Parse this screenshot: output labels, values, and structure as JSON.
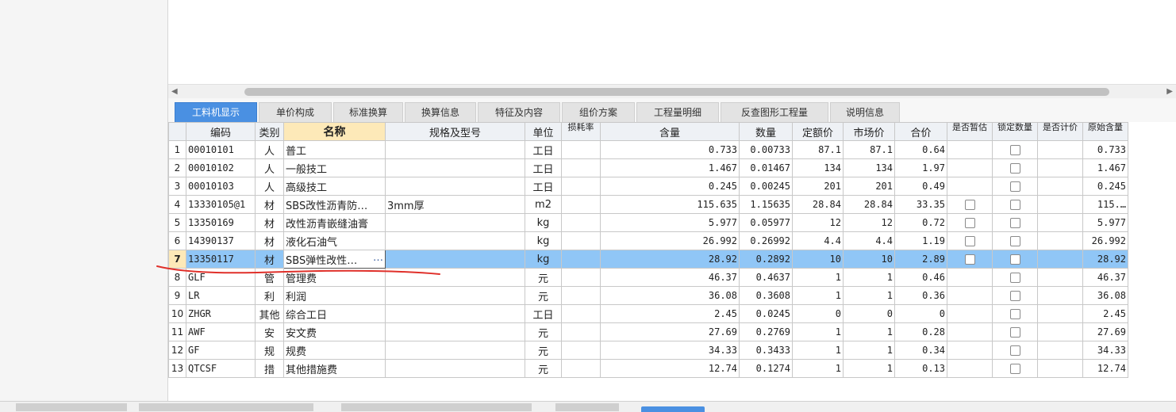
{
  "tabs": [
    {
      "label": "工料机显示",
      "active": true
    },
    {
      "label": "单价构成"
    },
    {
      "label": "标准换算"
    },
    {
      "label": "换算信息"
    },
    {
      "label": "特征及内容"
    },
    {
      "label": "组价方案"
    },
    {
      "label": "工程量明细"
    },
    {
      "label": "反查图形工程量"
    },
    {
      "label": "说明信息"
    }
  ],
  "columns": {
    "code": "编码",
    "type": "类别",
    "name": "名称",
    "spec": "规格及型号",
    "unit": "单位",
    "loss": "损耗率",
    "content": "含量",
    "qty": "数量",
    "quota_price": "定额价",
    "market_price": "市场价",
    "total": "合价",
    "is_temp": "是否暂估",
    "lock_qty": "锁定数量",
    "is_price": "是否计价",
    "orig_content": "原始含量"
  },
  "rows": [
    {
      "n": "1",
      "code": "00010101",
      "type": "人",
      "name": "普工",
      "spec": "",
      "unit": "工日",
      "content": "0.733",
      "qty": "0.00733",
      "quota": "87.1",
      "market": "87.1",
      "total": "0.64",
      "temp_cb": false,
      "orig": "0.733"
    },
    {
      "n": "2",
      "code": "00010102",
      "type": "人",
      "name": "一般技工",
      "spec": "",
      "unit": "工日",
      "content": "1.467",
      "qty": "0.01467",
      "quota": "134",
      "market": "134",
      "total": "1.97",
      "temp_cb": false,
      "orig": "1.467"
    },
    {
      "n": "3",
      "code": "00010103",
      "type": "人",
      "name": "高级技工",
      "spec": "",
      "unit": "工日",
      "content": "0.245",
      "qty": "0.00245",
      "quota": "201",
      "market": "201",
      "total": "0.49",
      "temp_cb": false,
      "orig": "0.245"
    },
    {
      "n": "4",
      "code": "13330105@1",
      "type": "材",
      "name": "SBS改性沥青防…",
      "spec": "3mm厚",
      "unit": "m2",
      "content": "115.635",
      "qty": "1.15635",
      "quota": "28.84",
      "market": "28.84",
      "total": "33.35",
      "temp_cb": true,
      "orig": "115.…"
    },
    {
      "n": "5",
      "code": "13350169",
      "type": "材",
      "name": "改性沥青嵌缝油膏",
      "spec": "",
      "unit": "kg",
      "content": "5.977",
      "qty": "0.05977",
      "quota": "12",
      "market": "12",
      "total": "0.72",
      "temp_cb": true,
      "orig": "5.977"
    },
    {
      "n": "6",
      "code": "14390137",
      "type": "材",
      "name": "液化石油气",
      "spec": "",
      "unit": "kg",
      "content": "26.992",
      "qty": "0.26992",
      "quota": "4.4",
      "market": "4.4",
      "total": "1.19",
      "temp_cb": true,
      "orig": "26.992"
    },
    {
      "n": "7",
      "code": "13350117",
      "type": "材",
      "name": "SBS弹性改性…",
      "spec": "",
      "unit": "kg",
      "content": "28.92",
      "qty": "0.2892",
      "quota": "10",
      "market": "10",
      "total": "2.89",
      "temp_cb": true,
      "orig": "28.92",
      "selected": true
    },
    {
      "n": "8",
      "code": "GLF",
      "type": "管",
      "name": "管理费",
      "spec": "",
      "unit": "元",
      "content": "46.37",
      "qty": "0.4637",
      "quota": "1",
      "market": "1",
      "total": "0.46",
      "temp_cb": false,
      "orig": "46.37"
    },
    {
      "n": "9",
      "code": "LR",
      "type": "利",
      "name": "利润",
      "spec": "",
      "unit": "元",
      "content": "36.08",
      "qty": "0.3608",
      "quota": "1",
      "market": "1",
      "total": "0.36",
      "temp_cb": false,
      "orig": "36.08"
    },
    {
      "n": "10",
      "code": "ZHGR",
      "type": "其他",
      "name": "综合工日",
      "spec": "",
      "unit": "工日",
      "content": "2.45",
      "qty": "0.0245",
      "quota": "0",
      "market": "0",
      "total": "0",
      "temp_cb": false,
      "orig": "2.45"
    },
    {
      "n": "11",
      "code": "AWF",
      "type": "安",
      "name": "安文费",
      "spec": "",
      "unit": "元",
      "content": "27.69",
      "qty": "0.2769",
      "quota": "1",
      "market": "1",
      "total": "0.28",
      "temp_cb": false,
      "orig": "27.69"
    },
    {
      "n": "12",
      "code": "GF",
      "type": "规",
      "name": "规费",
      "spec": "",
      "unit": "元",
      "content": "34.33",
      "qty": "0.3433",
      "quota": "1",
      "market": "1",
      "total": "0.34",
      "temp_cb": false,
      "orig": "34.33"
    },
    {
      "n": "13",
      "code": "QTCSF",
      "type": "措",
      "name": "其他措施费",
      "spec": "",
      "unit": "元",
      "content": "12.74",
      "qty": "0.1274",
      "quota": "1",
      "market": "1",
      "total": "0.13",
      "temp_cb": false,
      "orig": "12.74"
    }
  ],
  "edit_ellipsis": "…",
  "colors": {
    "accent": "#4a90e2",
    "selected_row": "#90c6f6",
    "header_highlight": "#fde9b8",
    "annotation": "#e0302a"
  }
}
